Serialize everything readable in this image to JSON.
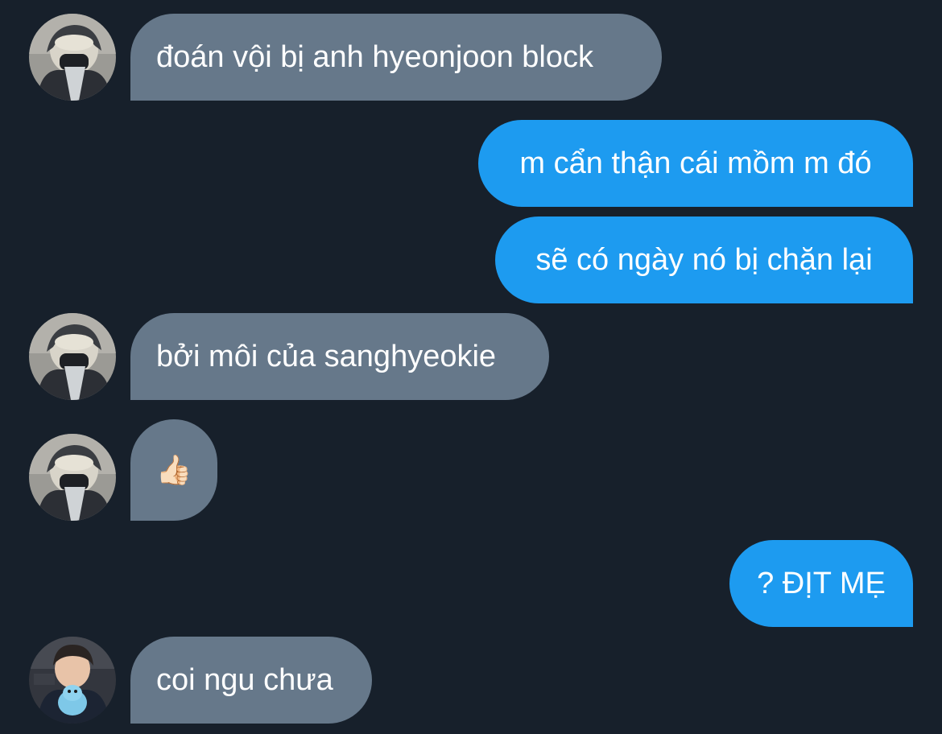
{
  "messages": [
    {
      "side": "in",
      "avatar": "person-a",
      "text": "đoán vội bị anh hyeonjoon block"
    },
    {
      "side": "out",
      "text": "m cẩn thận cái mồm m đó"
    },
    {
      "side": "out",
      "text": "sẽ có ngày nó bị chặn lại"
    },
    {
      "side": "in",
      "avatar": "person-a",
      "text": "bởi môi của sanghyeokie"
    },
    {
      "side": "in",
      "avatar": "person-a",
      "text": "👍🏻"
    },
    {
      "side": "out",
      "text": "? ĐỊT MẸ"
    },
    {
      "side": "in",
      "avatar": "person-b",
      "text": "coi ngu chưa"
    }
  ],
  "colors": {
    "background": "#17202b",
    "incoming_bubble": "#66788a",
    "outgoing_bubble": "#1d9bf0",
    "text": "#ffffff"
  }
}
